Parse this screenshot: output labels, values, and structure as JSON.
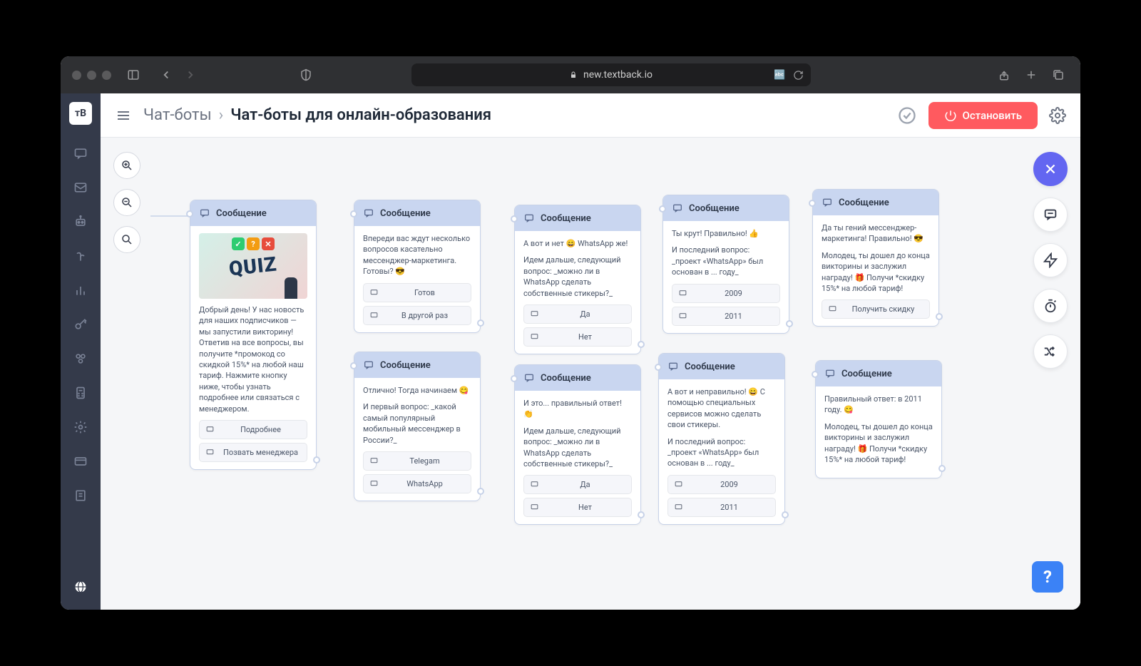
{
  "browser": {
    "url": "new.textback.io",
    "translate_icon": "translate-icon",
    "reload_icon": "reload-icon"
  },
  "sidebar": {
    "logo_text": "тВ"
  },
  "header": {
    "breadcrumb_1": "Чат-боты",
    "breadcrumb_2": "Чат-боты для онлайн-образования",
    "stop_label": "Остановить"
  },
  "nodes": {
    "n1": {
      "title": "Сообщение",
      "text": "Добрый день! У нас новость для наших подписчиков — мы запустили викторину! Ответив на все вопросы, вы получите *промокод со скидкой 15%* на любой наш тариф. Нажмите кнопку ниже, чтобы узнать подробнее или связаться с менеджером.",
      "quiz_label": "QUIZ",
      "btn1": "Подробнее",
      "btn2": "Позвать менеджера"
    },
    "n2": {
      "title": "Сообщение",
      "text": "Впереди вас ждут несколько вопросов касательно мессенджер-маркетинга. Готовы? 😎",
      "btn1": "Готов",
      "btn2": "В другой раз"
    },
    "n3": {
      "title": "Сообщение",
      "text1": "Отлично! Тогда начинаем 😋",
      "text2": "И первый вопрос: _какой самый популярный мобильный мессенджер в России?_",
      "btn1": "Telegam",
      "btn2": "WhatsApp"
    },
    "n4": {
      "title": "Сообщение",
      "text1": "А вот и нет 😄 WhatsApp же!",
      "text2": "Идем дальше, следующий вопрос: _можно ли в WhatsApp сделать собственные стикеры?_",
      "btn1": "Да",
      "btn2": "Нет"
    },
    "n5": {
      "title": "Сообщение",
      "text1": "И это... правильный ответ! 👏",
      "text2": "Идем дальше, следующий вопрос: _можно ли в WhatsApp сделать собственные стикеры?_",
      "btn1": "Да",
      "btn2": "Нет"
    },
    "n6": {
      "title": "Сообщение",
      "text1": "Ты крут! Правильно! 👍",
      "text2": "И последний вопрос: _проект «WhatsApp» был основан в ... году_",
      "btn1": "2009",
      "btn2": "2011"
    },
    "n7": {
      "title": "Сообщение",
      "text1": "А вот и неправильно! 😄 С помощью специальных сервисов можно сделать свои стикеры.",
      "text2": "И последний вопрос: _проект «WhatsApp» был основан в ... году_",
      "btn1": "2009",
      "btn2": "2011"
    },
    "n8": {
      "title": "Сообщение",
      "text1": "Да ты гений мессенджер-маркетинга! Правильно! 😎",
      "text2": "Молодец, ты дошел до конца викторины и заслужил награду! 🎁 Получи *скидку 15%* на любой тариф!",
      "btn1": "Получить скидку"
    },
    "n9": {
      "title": "Сообщение",
      "text1": "Правильный ответ: в 2011 году. 😋",
      "text2": "Молодец, ты дошел до конца викторины и заслужил награду! 🎁 Получи *скидку 15%* на любой тариф!"
    }
  }
}
